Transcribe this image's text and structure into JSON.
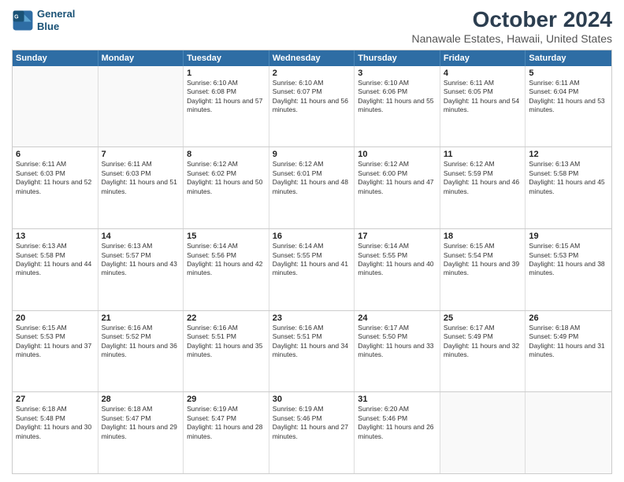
{
  "header": {
    "logo_line1": "General",
    "logo_line2": "Blue",
    "month": "October 2024",
    "location": "Nanawale Estates, Hawaii, United States"
  },
  "weekdays": [
    "Sunday",
    "Monday",
    "Tuesday",
    "Wednesday",
    "Thursday",
    "Friday",
    "Saturday"
  ],
  "rows": [
    [
      {
        "day": "",
        "sunrise": "",
        "sunset": "",
        "daylight": ""
      },
      {
        "day": "",
        "sunrise": "",
        "sunset": "",
        "daylight": ""
      },
      {
        "day": "1",
        "sunrise": "Sunrise: 6:10 AM",
        "sunset": "Sunset: 6:08 PM",
        "daylight": "Daylight: 11 hours and 57 minutes."
      },
      {
        "day": "2",
        "sunrise": "Sunrise: 6:10 AM",
        "sunset": "Sunset: 6:07 PM",
        "daylight": "Daylight: 11 hours and 56 minutes."
      },
      {
        "day": "3",
        "sunrise": "Sunrise: 6:10 AM",
        "sunset": "Sunset: 6:06 PM",
        "daylight": "Daylight: 11 hours and 55 minutes."
      },
      {
        "day": "4",
        "sunrise": "Sunrise: 6:11 AM",
        "sunset": "Sunset: 6:05 PM",
        "daylight": "Daylight: 11 hours and 54 minutes."
      },
      {
        "day": "5",
        "sunrise": "Sunrise: 6:11 AM",
        "sunset": "Sunset: 6:04 PM",
        "daylight": "Daylight: 11 hours and 53 minutes."
      }
    ],
    [
      {
        "day": "6",
        "sunrise": "Sunrise: 6:11 AM",
        "sunset": "Sunset: 6:03 PM",
        "daylight": "Daylight: 11 hours and 52 minutes."
      },
      {
        "day": "7",
        "sunrise": "Sunrise: 6:11 AM",
        "sunset": "Sunset: 6:03 PM",
        "daylight": "Daylight: 11 hours and 51 minutes."
      },
      {
        "day": "8",
        "sunrise": "Sunrise: 6:12 AM",
        "sunset": "Sunset: 6:02 PM",
        "daylight": "Daylight: 11 hours and 50 minutes."
      },
      {
        "day": "9",
        "sunrise": "Sunrise: 6:12 AM",
        "sunset": "Sunset: 6:01 PM",
        "daylight": "Daylight: 11 hours and 48 minutes."
      },
      {
        "day": "10",
        "sunrise": "Sunrise: 6:12 AM",
        "sunset": "Sunset: 6:00 PM",
        "daylight": "Daylight: 11 hours and 47 minutes."
      },
      {
        "day": "11",
        "sunrise": "Sunrise: 6:12 AM",
        "sunset": "Sunset: 5:59 PM",
        "daylight": "Daylight: 11 hours and 46 minutes."
      },
      {
        "day": "12",
        "sunrise": "Sunrise: 6:13 AM",
        "sunset": "Sunset: 5:58 PM",
        "daylight": "Daylight: 11 hours and 45 minutes."
      }
    ],
    [
      {
        "day": "13",
        "sunrise": "Sunrise: 6:13 AM",
        "sunset": "Sunset: 5:58 PM",
        "daylight": "Daylight: 11 hours and 44 minutes."
      },
      {
        "day": "14",
        "sunrise": "Sunrise: 6:13 AM",
        "sunset": "Sunset: 5:57 PM",
        "daylight": "Daylight: 11 hours and 43 minutes."
      },
      {
        "day": "15",
        "sunrise": "Sunrise: 6:14 AM",
        "sunset": "Sunset: 5:56 PM",
        "daylight": "Daylight: 11 hours and 42 minutes."
      },
      {
        "day": "16",
        "sunrise": "Sunrise: 6:14 AM",
        "sunset": "Sunset: 5:55 PM",
        "daylight": "Daylight: 11 hours and 41 minutes."
      },
      {
        "day": "17",
        "sunrise": "Sunrise: 6:14 AM",
        "sunset": "Sunset: 5:55 PM",
        "daylight": "Daylight: 11 hours and 40 minutes."
      },
      {
        "day": "18",
        "sunrise": "Sunrise: 6:15 AM",
        "sunset": "Sunset: 5:54 PM",
        "daylight": "Daylight: 11 hours and 39 minutes."
      },
      {
        "day": "19",
        "sunrise": "Sunrise: 6:15 AM",
        "sunset": "Sunset: 5:53 PM",
        "daylight": "Daylight: 11 hours and 38 minutes."
      }
    ],
    [
      {
        "day": "20",
        "sunrise": "Sunrise: 6:15 AM",
        "sunset": "Sunset: 5:53 PM",
        "daylight": "Daylight: 11 hours and 37 minutes."
      },
      {
        "day": "21",
        "sunrise": "Sunrise: 6:16 AM",
        "sunset": "Sunset: 5:52 PM",
        "daylight": "Daylight: 11 hours and 36 minutes."
      },
      {
        "day": "22",
        "sunrise": "Sunrise: 6:16 AM",
        "sunset": "Sunset: 5:51 PM",
        "daylight": "Daylight: 11 hours and 35 minutes."
      },
      {
        "day": "23",
        "sunrise": "Sunrise: 6:16 AM",
        "sunset": "Sunset: 5:51 PM",
        "daylight": "Daylight: 11 hours and 34 minutes."
      },
      {
        "day": "24",
        "sunrise": "Sunrise: 6:17 AM",
        "sunset": "Sunset: 5:50 PM",
        "daylight": "Daylight: 11 hours and 33 minutes."
      },
      {
        "day": "25",
        "sunrise": "Sunrise: 6:17 AM",
        "sunset": "Sunset: 5:49 PM",
        "daylight": "Daylight: 11 hours and 32 minutes."
      },
      {
        "day": "26",
        "sunrise": "Sunrise: 6:18 AM",
        "sunset": "Sunset: 5:49 PM",
        "daylight": "Daylight: 11 hours and 31 minutes."
      }
    ],
    [
      {
        "day": "27",
        "sunrise": "Sunrise: 6:18 AM",
        "sunset": "Sunset: 5:48 PM",
        "daylight": "Daylight: 11 hours and 30 minutes."
      },
      {
        "day": "28",
        "sunrise": "Sunrise: 6:18 AM",
        "sunset": "Sunset: 5:47 PM",
        "daylight": "Daylight: 11 hours and 29 minutes."
      },
      {
        "day": "29",
        "sunrise": "Sunrise: 6:19 AM",
        "sunset": "Sunset: 5:47 PM",
        "daylight": "Daylight: 11 hours and 28 minutes."
      },
      {
        "day": "30",
        "sunrise": "Sunrise: 6:19 AM",
        "sunset": "Sunset: 5:46 PM",
        "daylight": "Daylight: 11 hours and 27 minutes."
      },
      {
        "day": "31",
        "sunrise": "Sunrise: 6:20 AM",
        "sunset": "Sunset: 5:46 PM",
        "daylight": "Daylight: 11 hours and 26 minutes."
      },
      {
        "day": "",
        "sunrise": "",
        "sunset": "",
        "daylight": ""
      },
      {
        "day": "",
        "sunrise": "",
        "sunset": "",
        "daylight": ""
      }
    ]
  ]
}
